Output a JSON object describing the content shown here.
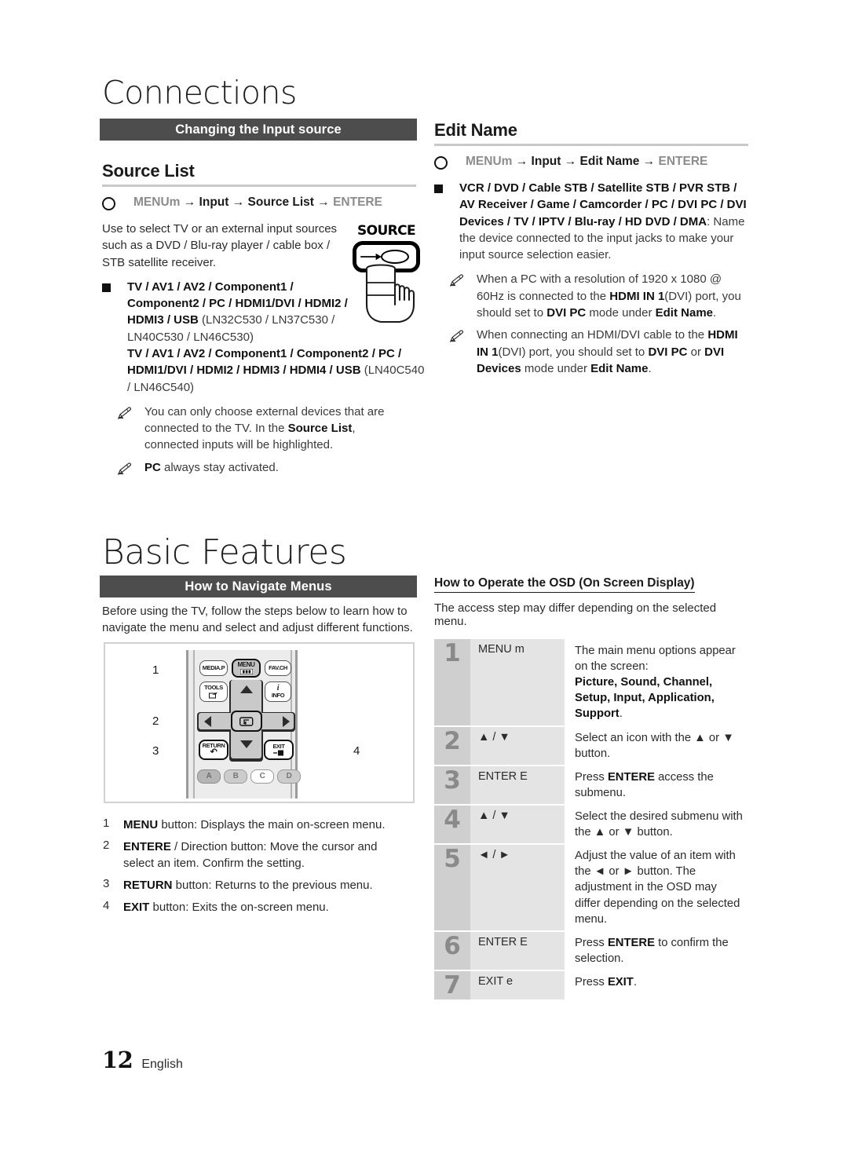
{
  "page": {
    "number": "12",
    "language": "English"
  },
  "chapters": [
    {
      "title": "Connections"
    },
    {
      "title": "Basic Features"
    }
  ],
  "connections": {
    "section_bar": "Changing the Input source",
    "source_list": {
      "heading": "Source List",
      "path": {
        "menu": "MENUm",
        "a1": "→",
        "step1": "Input",
        "a2": "→",
        "step2": "Source List",
        "a3": "→",
        "enter": "ENTERE"
      },
      "intro": "Use to select TV or an external input sources such as a DVD / Blu-ray player / cable box / STB satellite receiver.",
      "bullet": {
        "bold1": "TV / AV1 / AV2 / Component1 / Component2 / PC / HDMI1/DVI / HDMI2 / HDMI3 / USB",
        "models1": "(LN32C530 / LN37C530 / LN40C530 / LN46C530)",
        "bold2": "TV / AV1 / AV2 / Component1 / Component2 / PC / HDMI1/DVI / HDMI2 / HDMI3 / HDMI4 / USB",
        "models2": "(LN40C540 / LN46C540)"
      },
      "notes": [
        {
          "pre": "You can only choose external devices that are connected to the TV. In the ",
          "bold": "Source List",
          "post": ", connected inputs will be highlighted."
        },
        {
          "pre": "",
          "bold": "PC",
          "post": " always stay activated."
        }
      ],
      "source_button_label": "SOURCE"
    },
    "edit_name": {
      "heading": "Edit Name",
      "path": {
        "menu": "MENUm",
        "a1": "→",
        "step1": "Input",
        "a2": "→",
        "step2": "Edit Name",
        "a3": "→",
        "enter": "ENTERE"
      },
      "bullet": {
        "bold": "VCR / DVD / Cable STB / Satellite STB / PVR STB / AV Receiver / Game / Camcorder / PC / DVI PC / DVI Devices / TV / IPTV / Blu-ray / HD DVD / DMA",
        "rest": ": Name the device connected to the input jacks to make your input source selection easier."
      },
      "notes": [
        {
          "p1": "When a PC with a resolution of 1920 x 1080 @ 60Hz is connected to the ",
          "b1": "HDMI IN 1",
          "p2": "(DVI) port, you should set to ",
          "b2": "DVI PC",
          "p3": " mode under ",
          "b3": "Edit Name",
          "p4": "."
        },
        {
          "p1": "When connecting an HDMI/DVI cable to the ",
          "b1": "HDMI IN 1",
          "p2": "(DVI) port, you should set to ",
          "b2": "DVI PC",
          "p3": " or ",
          "b3": "DVI Devices",
          "p4": " mode under ",
          "b4": "Edit Name",
          "p5": "."
        }
      ]
    }
  },
  "basic_features": {
    "section_bar": "How to Navigate Menus",
    "intro": "Before using the TV, follow the steps below to learn how to navigate the menu and select and adjust different functions.",
    "remote": {
      "callouts": [
        "1",
        "2",
        "3",
        "4"
      ],
      "buttons": {
        "media_p": "MEDIA.P",
        "menu": "MENU",
        "fav_ch": "FAV.CH",
        "tools": "TOOLS",
        "info_i": "i",
        "info": "INFO",
        "return": "RETURN",
        "exit": "EXIT",
        "color_a": "A",
        "color_b": "B",
        "color_c": "C",
        "color_d": "D"
      }
    },
    "legend": [
      {
        "num": "1",
        "bold": "MENU",
        "text": " button: Displays the main on-screen menu."
      },
      {
        "num": "2",
        "bold": "ENTERE",
        "text": " / Direction button: Move the cursor and select an item. Confirm the setting."
      },
      {
        "num": "3",
        "bold": "RETURN",
        "text": " button: Returns to the previous menu."
      },
      {
        "num": "4",
        "bold": "EXIT",
        "text": " button: Exits the on-screen menu."
      }
    ],
    "osd": {
      "title": "How to Operate the OSD (On Screen Display)",
      "intro": "The access step may differ depending on the selected menu.",
      "rows": [
        {
          "num": "1",
          "key": "MENU m",
          "desc_plain": "The main menu options appear on the screen:",
          "desc_bold": "Picture, Sound, Channel, Setup, Input, Application, Support",
          "desc_tail": "."
        },
        {
          "num": "2",
          "key": "▲ / ▼",
          "desc_plain": "Select an icon with the ▲ or ▼ button.",
          "desc_bold": "",
          "desc_tail": ""
        },
        {
          "num": "3",
          "key": "ENTER E",
          "desc_plain": "Press ",
          "desc_bold": "ENTERE",
          "desc_tail": "  access the submenu."
        },
        {
          "num": "4",
          "key": "▲ / ▼",
          "desc_plain": "Select the desired submenu with the ▲ or ▼ button.",
          "desc_bold": "",
          "desc_tail": ""
        },
        {
          "num": "5",
          "key": "◄ / ►",
          "desc_plain": "Adjust the value of an item with the ◄ or ► button. The adjustment in the OSD may differ depending on the selected menu.",
          "desc_bold": "",
          "desc_tail": ""
        },
        {
          "num": "6",
          "key": "ENTER E",
          "desc_plain": "Press ",
          "desc_bold": "ENTERE",
          "desc_tail": "  to confirm the selection."
        },
        {
          "num": "7",
          "key": "EXIT e",
          "desc_plain": "Press ",
          "desc_bold": "EXIT",
          "desc_tail": "."
        }
      ]
    }
  },
  "colors": {
    "section_bar_bg": "#4d4d4d",
    "rule_gray": "#c9c9c9",
    "osd_num_bg": "#cfcfcf",
    "osd_key_bg": "#e4e4e4",
    "gray_glyph": "#8c8c8c"
  }
}
